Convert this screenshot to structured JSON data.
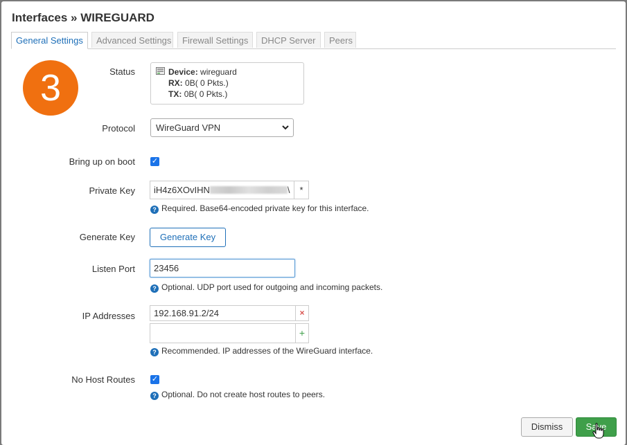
{
  "title": "Interfaces » WIREGUARD",
  "tabs": [
    {
      "label": "General Settings",
      "active": true
    },
    {
      "label": "Advanced Settings"
    },
    {
      "label": "Firewall Settings"
    },
    {
      "label": "DHCP Server"
    },
    {
      "label": "Peers"
    }
  ],
  "badge": "3",
  "status": {
    "label": "Status",
    "device_key": "Device:",
    "device_value": "wireguard",
    "rx_key": "RX:",
    "rx_value": "0B",
    "rx_pkts": "( 0 Pkts.)",
    "tx_key": "TX:",
    "tx_value": "0B",
    "tx_pkts": "( 0 Pkts.)"
  },
  "protocol": {
    "label": "Protocol",
    "value": "WireGuard VPN"
  },
  "bring_up_on_boot": {
    "label": "Bring up on boot",
    "checked": true
  },
  "private_key": {
    "label": "Private Key",
    "value": "iH4z6XOvIHN",
    "value_tail": "\\",
    "addon": "*",
    "hint": "Required. Base64-encoded private key for this interface."
  },
  "generate_key": {
    "label": "Generate Key",
    "button": "Generate Key"
  },
  "listen_port": {
    "label": "Listen Port",
    "value": "23456",
    "hint": "Optional. UDP port used for outgoing and incoming packets."
  },
  "ip_addresses": {
    "label": "IP Addresses",
    "values": [
      "192.168.91.2/24",
      ""
    ],
    "remove_symbol": "×",
    "add_symbol": "+",
    "hint": "Recommended. IP addresses of the WireGuard interface."
  },
  "no_host_routes": {
    "label": "No Host Routes",
    "checked": true,
    "hint": "Optional. Do not create host routes to peers."
  },
  "hint_icon": "?",
  "check_mark": "✓",
  "footer": {
    "dismiss": "Dismiss",
    "save": "Save"
  },
  "colors": {
    "accent": "#1e6fb8",
    "save": "#3f9f4a",
    "badge": "#f07010",
    "checkbox": "#1a73e8"
  }
}
